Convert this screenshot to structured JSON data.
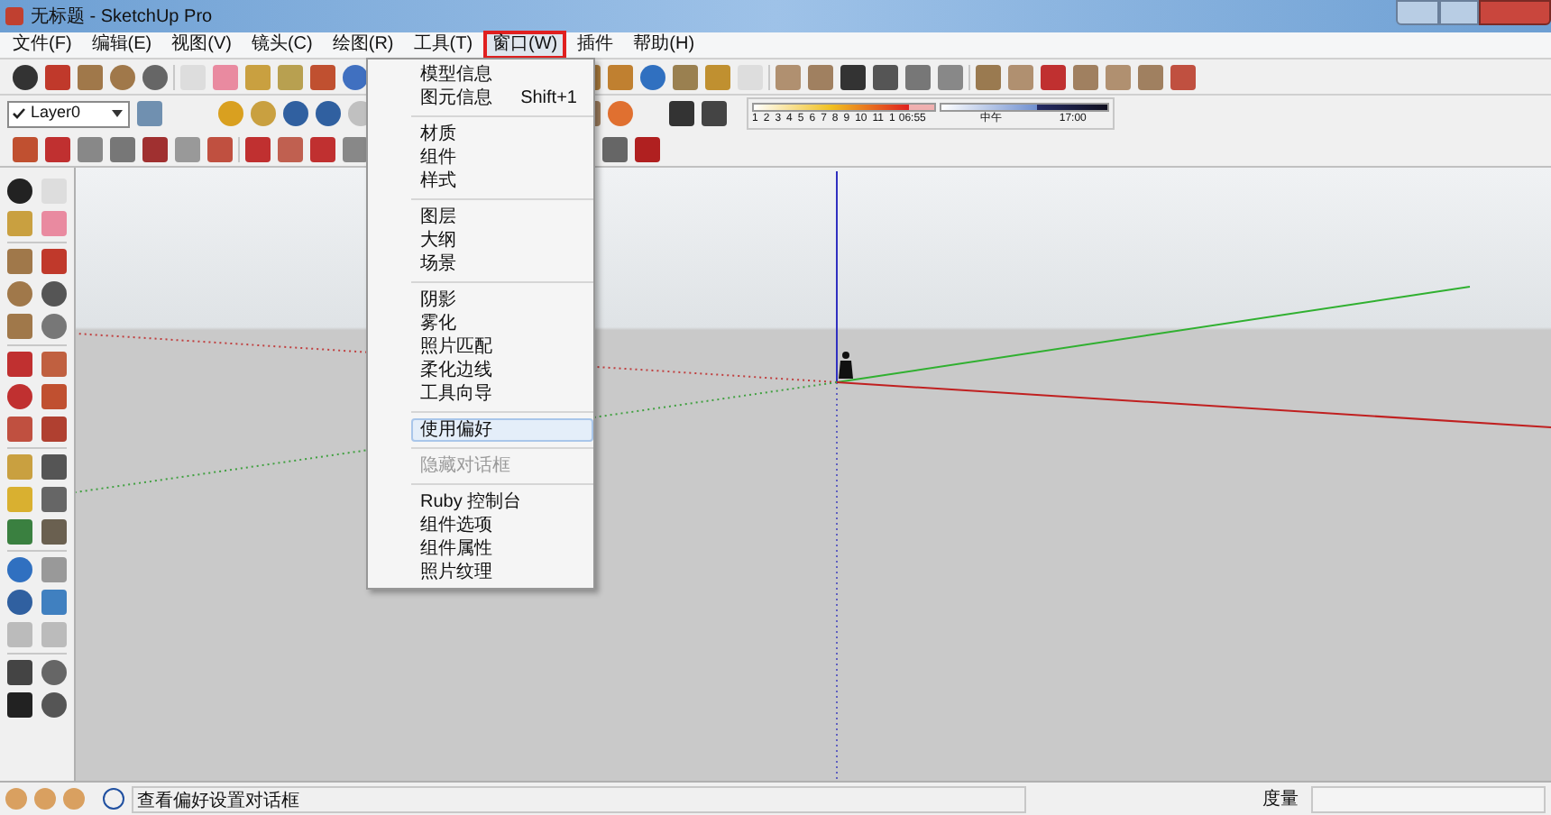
{
  "window": {
    "title": "无标题 - SketchUp Pro"
  },
  "menu_bar": [
    {
      "label": "文件(F)",
      "selected": false
    },
    {
      "label": "编辑(E)",
      "selected": false
    },
    {
      "label": "视图(V)",
      "selected": false
    },
    {
      "label": "镜头(C)",
      "selected": false
    },
    {
      "label": "绘图(R)",
      "selected": false
    },
    {
      "label": "工具(T)",
      "selected": false
    },
    {
      "label": "窗口(W)",
      "selected": true
    },
    {
      "label": "插件",
      "selected": false
    },
    {
      "label": "帮助(H)",
      "selected": false
    }
  ],
  "layer_select": {
    "value": "Layer0"
  },
  "shadow_settings": {
    "month_slider": {
      "level": 0.86
    },
    "time_slider": {
      "level": 0.58
    },
    "months": [
      "1",
      "2",
      "3",
      "4",
      "5",
      "6",
      "7",
      "8",
      "9",
      "10",
      "11",
      "1"
    ],
    "time_start": "06:55",
    "time_mid": "中午",
    "time_end": "17:00"
  },
  "dropdown_menu": {
    "sections": [
      [
        {
          "label": "模型信息",
          "selected": false,
          "disabled": false
        },
        {
          "label": "图元信息",
          "shortcut": "Shift+1",
          "selected": false,
          "disabled": false
        }
      ],
      [
        {
          "label": "材质",
          "selected": false,
          "disabled": false
        },
        {
          "label": "组件",
          "selected": false,
          "disabled": false
        },
        {
          "label": "样式",
          "selected": false,
          "disabled": false
        }
      ],
      [
        {
          "label": "图层",
          "selected": false,
          "disabled": false
        },
        {
          "label": "大纲",
          "selected": false,
          "disabled": false
        },
        {
          "label": "场景",
          "selected": false,
          "disabled": false
        }
      ],
      [
        {
          "label": "阴影",
          "selected": false,
          "disabled": false
        },
        {
          "label": "雾化",
          "selected": false,
          "disabled": false
        },
        {
          "label": "照片匹配",
          "selected": false,
          "disabled": false
        },
        {
          "label": "柔化边线",
          "selected": false,
          "disabled": false
        },
        {
          "label": "工具向导",
          "selected": false,
          "disabled": false
        }
      ],
      [
        {
          "label": "使用偏好",
          "selected": true,
          "disabled": false
        }
      ],
      [
        {
          "label": "隐藏对话框",
          "selected": false,
          "disabled": true
        }
      ],
      [
        {
          "label": "Ruby 控制台",
          "selected": false,
          "disabled": false
        },
        {
          "label": "组件选项",
          "selected": false,
          "disabled": false
        },
        {
          "label": "组件属性",
          "selected": false,
          "disabled": false
        },
        {
          "label": "照片纹理",
          "selected": false,
          "disabled": false
        }
      ]
    ]
  },
  "status_bar": {
    "message": "查看偏好设置对话框",
    "measure_label": "度量"
  }
}
